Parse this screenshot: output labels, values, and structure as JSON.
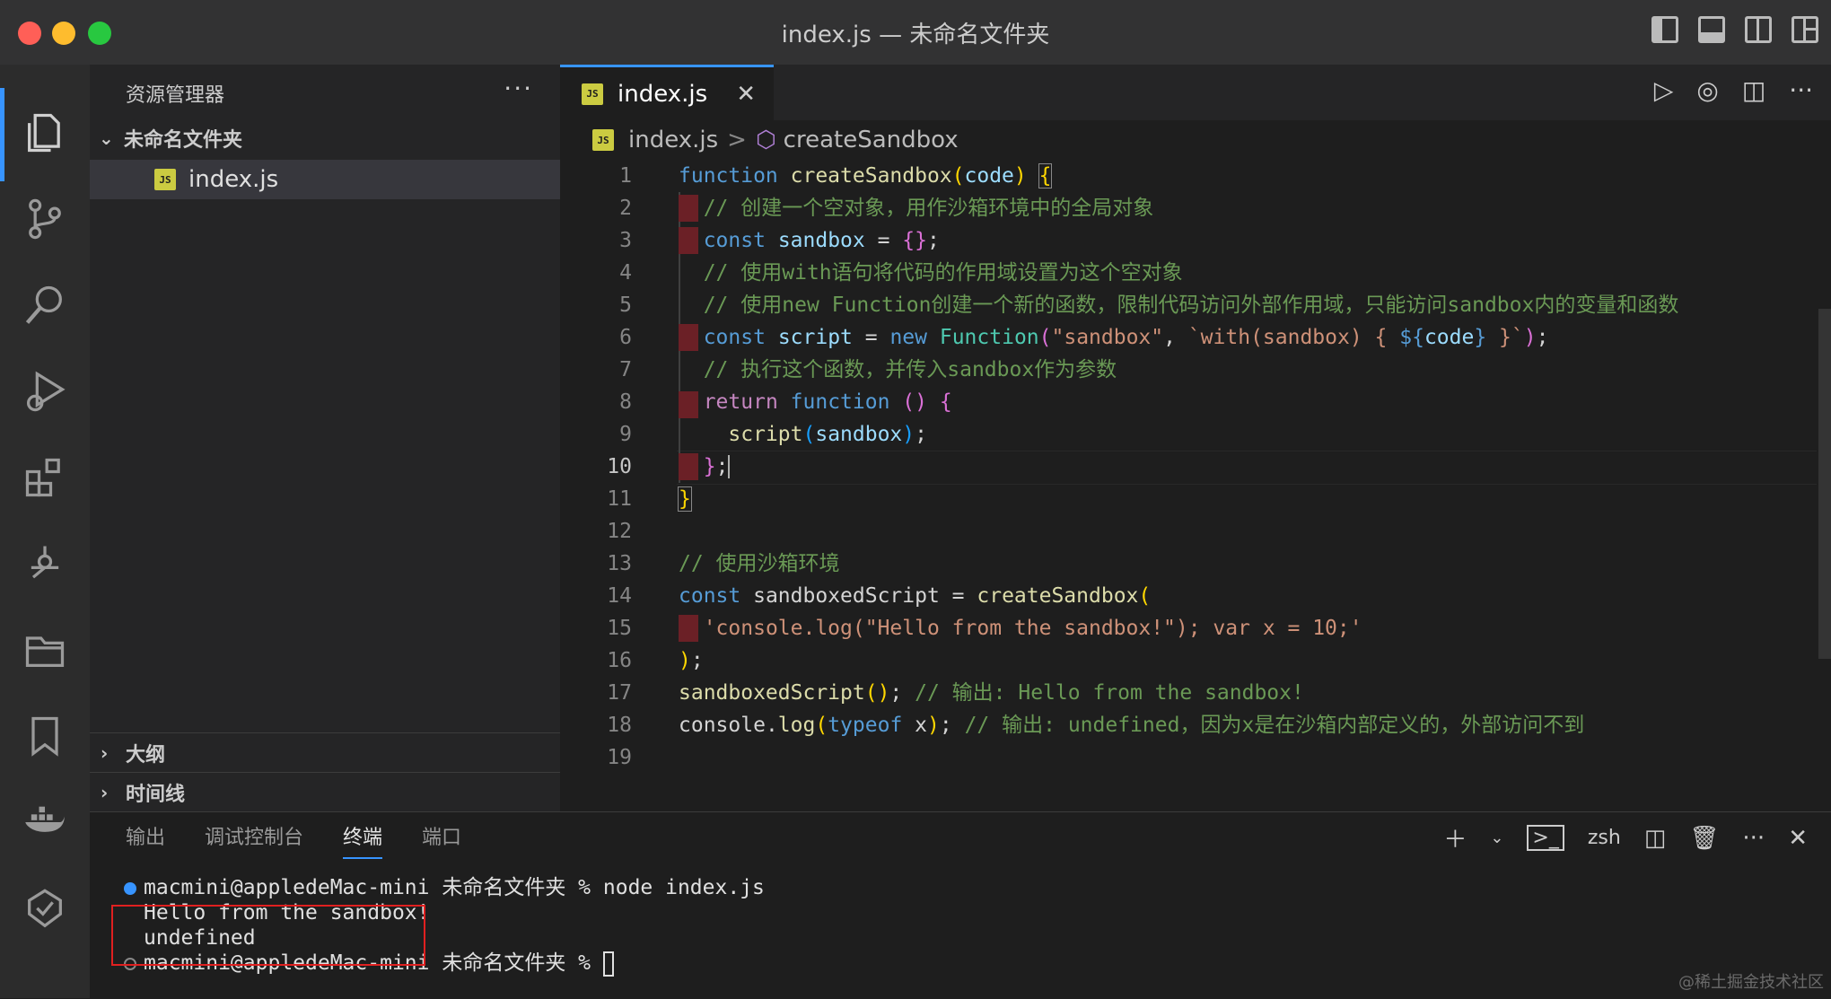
{
  "window": {
    "title": "index.js — 未命名文件夹"
  },
  "sidebar": {
    "header": "资源管理器",
    "more": "···",
    "folder": "未命名文件夹",
    "file": "index.js",
    "sections": [
      "大纲",
      "时间线"
    ]
  },
  "tab": {
    "label": "index.js",
    "close": "✕",
    "icon": "JS"
  },
  "breadcrumb": {
    "file": "index.js",
    "separator": ">",
    "symbol": "createSandbox"
  },
  "editor": {
    "current_line": 10,
    "line_numbers": [
      "1",
      "2",
      "3",
      "4",
      "5",
      "6",
      "7",
      "8",
      "9",
      "10",
      "11",
      "12",
      "13",
      "14",
      "15",
      "16",
      "17",
      "18",
      "19"
    ]
  },
  "panel": {
    "tabs": [
      "输出",
      "调试控制台",
      "终端",
      "端口"
    ],
    "active_tab": "终端",
    "shell": "zsh",
    "terminal": {
      "line1_prompt": "macmini@appledeMac-mini 未命名文件夹 % ",
      "line1_command": "node index.js",
      "output1": "Hello from the sandbox!",
      "output2": "undefined",
      "line4_prompt": "macmini@appledeMac-mini 未命名文件夹 % "
    }
  },
  "watermark": "@稀土掘金技术社区",
  "colors": {
    "accent": "#3794ff",
    "js_icon": "#cbcb41",
    "highlight_box": "#e02020"
  }
}
